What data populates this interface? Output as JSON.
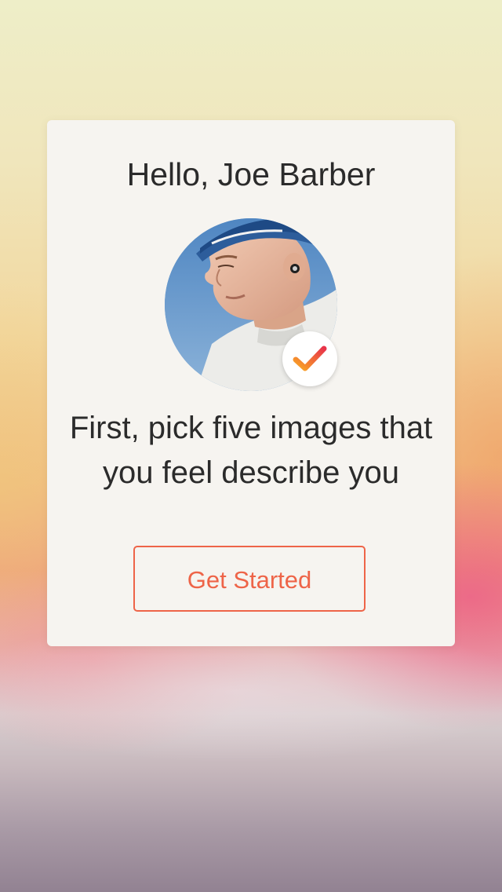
{
  "onboarding": {
    "greeting": "Hello, Joe Barber",
    "prompt_line1": "First, pick five images that",
    "prompt_line2": "you feel describe you",
    "cta_label": "Get Started"
  },
  "profile": {
    "avatar_icon": "profile-photo",
    "verified_icon": "checkmark-icon"
  },
  "colors": {
    "accent": "#ee6448",
    "check_gradient_start": "#f9a825",
    "check_gradient_end": "#e8344a",
    "card_background": "#f6f4f0",
    "text": "#2b2b2b"
  }
}
